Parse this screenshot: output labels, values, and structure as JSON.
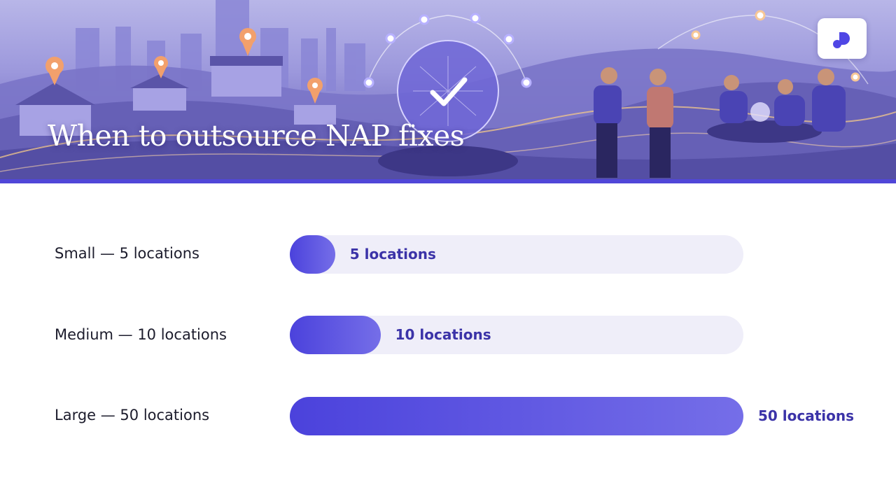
{
  "header": {
    "title": "When to outsource NAP fixes",
    "logo_icon": "brand-logo-icon",
    "illustration": "city-network-handshake-illustration"
  },
  "colors": {
    "accent": "#5046d8",
    "bar_start": "#4b42dc",
    "bar_end": "#756ee8",
    "track": "#efeef9",
    "value_text": "#3b33a8"
  },
  "chart_data": {
    "type": "bar",
    "orientation": "horizontal",
    "categories": [
      "Small — 5 locations",
      "Medium — 10 locations",
      "Large — 50 locations"
    ],
    "values": [
      5,
      10,
      50
    ],
    "value_labels": [
      "5 locations",
      "10 locations",
      "50 locations"
    ],
    "xlim": [
      0,
      50
    ],
    "grid": false,
    "legend": "none",
    "title": "When to outsource NAP fixes",
    "xlabel": "",
    "ylabel": ""
  }
}
